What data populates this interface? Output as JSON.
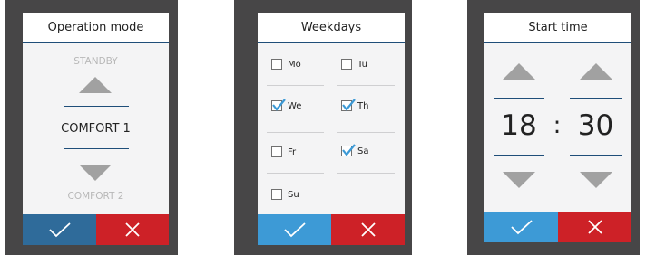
{
  "colors": {
    "frame": "#474647",
    "screen": "#f4f4f5",
    "accent_line": "#1f4e79",
    "ok_dark": "#2f6b9a",
    "ok_light": "#3d9ad6",
    "cancel": "#cd2127",
    "arrow": "#a1a1a1"
  },
  "operation_mode": {
    "title": "Operation mode",
    "previous": "STANDBY",
    "selected": "COMFORT 1",
    "next": "COMFORT 2"
  },
  "weekdays": {
    "title": "Weekdays",
    "days": [
      {
        "label": "Mo",
        "checked": false
      },
      {
        "label": "Tu",
        "checked": false
      },
      {
        "label": "We",
        "checked": true
      },
      {
        "label": "Th",
        "checked": true
      },
      {
        "label": "Fr",
        "checked": false
      },
      {
        "label": "Sa",
        "checked": true
      },
      {
        "label": "Su",
        "checked": false
      }
    ]
  },
  "start_time": {
    "title": "Start time",
    "hours": "18",
    "separator": ":",
    "minutes": "30"
  },
  "icons": {
    "confirm": "checkmark-icon",
    "cancel": "close-icon",
    "up": "arrow-up-icon",
    "down": "arrow-down-icon"
  }
}
